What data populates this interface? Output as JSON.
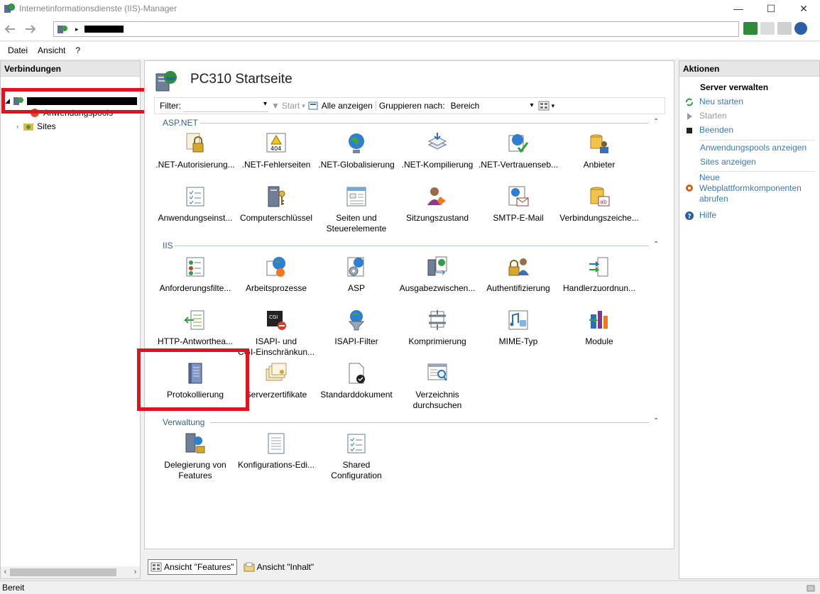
{
  "window": {
    "title": "Internetinformationsdienste (IIS)-Manager",
    "minimize": "—",
    "maximize": "☐",
    "close": "✕"
  },
  "address": {
    "separator": "▸"
  },
  "menu": [
    "Datei",
    "Ansicht",
    "?"
  ],
  "connections": {
    "header": "Verbindungen",
    "tree": {
      "app_pools": "Anwendungspools",
      "sites": "Sites"
    }
  },
  "center": {
    "title": "PC310 Startseite",
    "filter_label": "Filter:",
    "start_label": "Start",
    "show_all_label": "Alle anzeigen",
    "group_by_label": "Gruppieren nach:",
    "group_by_value": "Bereich",
    "sections": [
      {
        "name": "ASP.NET",
        "features": [
          [
            ".NET-Autorisierung...",
            ""
          ],
          [
            ".NET-Fehlerseiten",
            ""
          ],
          [
            ".NET-Globalisierung",
            ""
          ],
          [
            ".NET-Kompilierung",
            ""
          ],
          [
            ".NET-Vertrauenseb...",
            ""
          ],
          [
            "Anbieter",
            ""
          ],
          [
            "Anwendungseinst...",
            ""
          ],
          [
            "Computerschlüssel",
            ""
          ],
          [
            "Seiten und",
            "Steuerelemente"
          ],
          [
            "Sitzungszustand",
            ""
          ],
          [
            "SMTP-E-Mail",
            ""
          ],
          [
            "Verbindungszeiche...",
            ""
          ]
        ]
      },
      {
        "name": "IIS",
        "features": [
          [
            "Anforderungsfilte...",
            ""
          ],
          [
            "Arbeitsprozesse",
            ""
          ],
          [
            "ASP",
            ""
          ],
          [
            "Ausgabezwischen...",
            ""
          ],
          [
            "Authentifizierung",
            ""
          ],
          [
            "Handlerzuordnun...",
            ""
          ],
          [
            "HTTP-Antworthea...",
            ""
          ],
          [
            "ISAPI- und",
            "CGI-Einschränkun..."
          ],
          [
            "ISAPI-Filter",
            ""
          ],
          [
            "Komprimierung",
            ""
          ],
          [
            "MIME-Typ",
            ""
          ],
          [
            "Module",
            ""
          ],
          [
            "Protokollierung",
            ""
          ],
          [
            "Serverzertifikate",
            ""
          ],
          [
            "Standarddokument",
            ""
          ],
          [
            "Verzeichnis",
            "durchsuchen"
          ]
        ]
      },
      {
        "name": "Verwaltung",
        "features": [
          [
            "Delegierung von",
            "Features"
          ],
          [
            "Konfigurations-Edi...",
            ""
          ],
          [
            "Shared",
            "Configuration"
          ]
        ]
      }
    ],
    "tab_features": "Ansicht \"Features\"",
    "tab_content": "Ansicht \"Inhalt\""
  },
  "actions": {
    "header": "Aktionen",
    "group_title": "Server verwalten",
    "restart": "Neu starten",
    "start": "Starten",
    "stop": "Beenden",
    "show_app_pools": "Anwendungspools anzeigen",
    "show_sites": "Sites anzeigen",
    "get_components_1": "Neue",
    "get_components_2": "Webplattformkomponenten",
    "get_components_3": "abrufen",
    "help": "Hilfe"
  },
  "status": {
    "text": "Bereit"
  },
  "colors": {
    "accent": "#3a78c2",
    "highlight_box": "#e0141e"
  }
}
